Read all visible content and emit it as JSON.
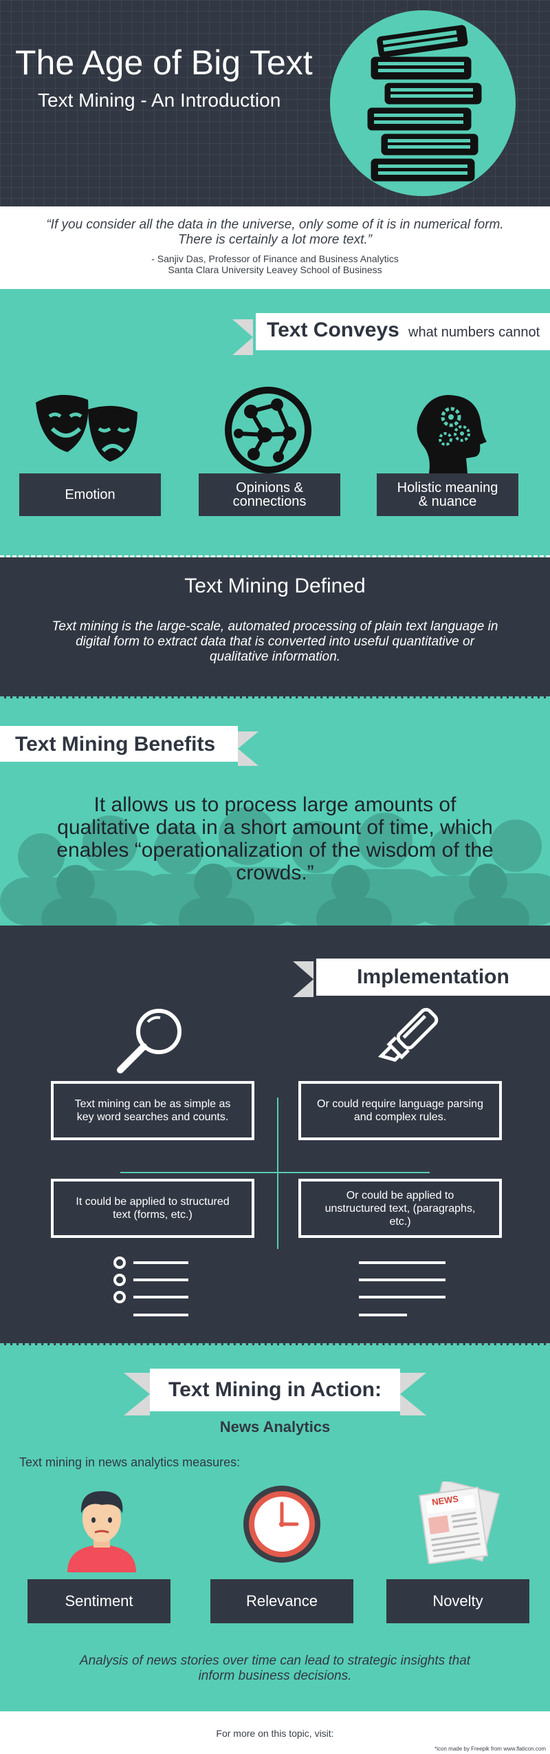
{
  "header": {
    "title": "The Age of Big Text",
    "subtitle": "Text Mining - An Introduction"
  },
  "quote": {
    "text": "“If you consider all the data in the universe, only some of it is in numerical form. There is certainly a lot more text.”",
    "attribution_line1": "- Sanjiv Das, Professor of Finance and Business Analytics",
    "attribution_line2": "Santa Clara University Leavey School of Business"
  },
  "conveys": {
    "heading": "Text Conveys",
    "heading_suffix": "what numbers cannot",
    "items": [
      {
        "label": "Emotion",
        "icon": "theater-masks-icon"
      },
      {
        "label": "Opinions & connections",
        "icon": "network-globe-icon"
      },
      {
        "label": "Holistic meaning & nuance",
        "icon": "head-gears-icon"
      }
    ]
  },
  "defined": {
    "heading": "Text Mining Defined",
    "body": "Text mining is the large-scale, automated processing of plain text language in digital form to extract data that is converted into useful quantitative or qualitative information."
  },
  "benefits": {
    "heading": "Text Mining Benefits",
    "body": "It allows us to process large amounts of qualitative data in a short amount of time, which enables “operationalization of the wisdom of the crowds.”"
  },
  "implementation": {
    "heading": "Implementation",
    "boxes": [
      "Text mining can be as simple as key word searches and counts.",
      "Or could require language parsing and complex rules.",
      "It could be applied to structured text (forms, etc.)",
      "Or could be applied to unstructured text, (paragraphs, etc.)"
    ]
  },
  "action": {
    "heading": "Text Mining in Action:",
    "subheading": "News Analytics",
    "intro": "Text mining in news analytics measures:",
    "measures": [
      "Sentiment",
      "Relevance",
      "Novelty"
    ],
    "news_label": "NEWS",
    "conclusion": "Analysis of news stories over time can lead to strategic insights that inform business decisions."
  },
  "footer": {
    "text": "For more on this topic, visit:",
    "credit": "*icon made by Freepik from www.flaticon.com"
  },
  "colors": {
    "dark": "#323843",
    "teal": "#57cdb5",
    "white": "#ffffff"
  }
}
